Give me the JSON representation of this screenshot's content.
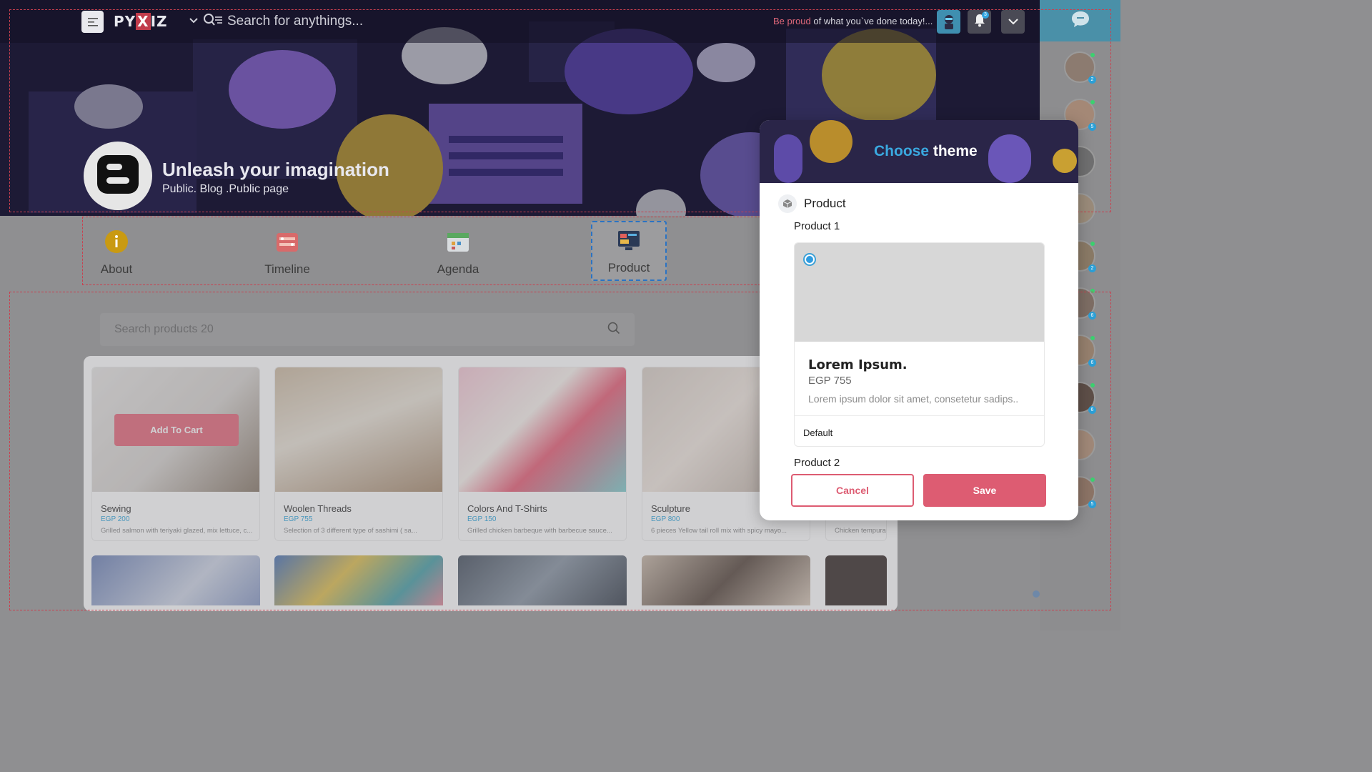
{
  "header": {
    "logo": {
      "prefix": "PY",
      "mark": "X",
      "suffix": "IZ"
    },
    "search_placeholder": "Search for anythings...",
    "motto_accent": "Be proud",
    "motto_rest": " of what you`ve done today!...",
    "notification_count": "3",
    "icons": [
      "menu-icon",
      "chevron-down-icon",
      "search-filter-icon",
      "mascot-icon",
      "bell-icon",
      "chevron-down-icon",
      "chat-icon"
    ]
  },
  "page": {
    "title": "Unleash your imagination",
    "subtitle": "Public. Blog .Public page"
  },
  "tabs": [
    {
      "label": "About",
      "icon": "info-icon"
    },
    {
      "label": "Timeline",
      "icon": "timeline-icon"
    },
    {
      "label": "Agenda",
      "icon": "agenda-icon"
    },
    {
      "label": "Product",
      "icon": "product-icon",
      "active": true
    }
  ],
  "products": {
    "search_placeholder": "Search products 20",
    "add_to_cart_label": "Add To Cart",
    "items": [
      {
        "name": "Sewing",
        "price": "EGP 200",
        "desc": "Grilled salmon with teriyaki glazed, mix lettuce, c..."
      },
      {
        "name": "Woolen Threads",
        "price": "EGP 755",
        "desc": "Selection of 3 different type of sashimi ( sa..."
      },
      {
        "name": "Colors And T-Shirts",
        "price": "EGP 150",
        "desc": "Grilled chicken barbeque with barbecue sauce..."
      },
      {
        "name": "Sculpture",
        "price": "EGP 800",
        "desc": "6 pieces Yellow tail roll mix with spicy mayo..."
      },
      {
        "name": "",
        "price": "",
        "desc": "Chicken tempura"
      }
    ]
  },
  "sidebar": {
    "badges": [
      "2",
      "5",
      "",
      "",
      "2",
      "6",
      "6",
      "6",
      "",
      "5"
    ]
  },
  "modal": {
    "title_accent": "Choose",
    "title_rest": " theme",
    "section_title": "Product",
    "product1_label": "Product 1",
    "option": {
      "name": "Lorem Ipsum.",
      "price": "EGP 755",
      "desc": "Lorem ipsum dolor sit amet, consetetur sadips..",
      "footer": "Default",
      "selected": true
    },
    "product2_label": "Product 2",
    "cancel_label": "Cancel",
    "save_label": "Save"
  },
  "colors": {
    "accent_blue": "#2ea7dd",
    "accent_pink": "#dd5c72",
    "banner_dark": "#201d3a"
  }
}
